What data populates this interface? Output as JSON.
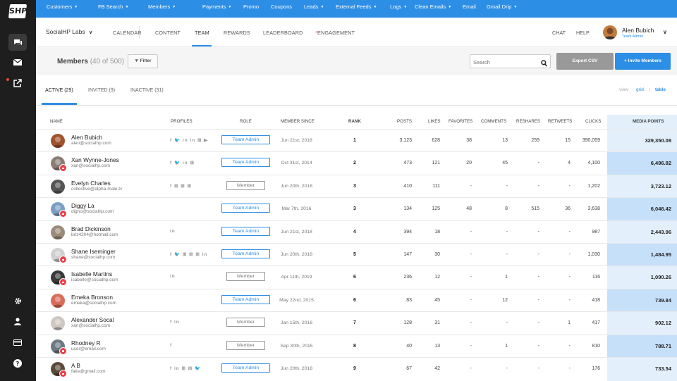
{
  "logo": "SHP",
  "nav": [
    {
      "label": "Customers",
      "caret": true
    },
    {
      "label": "FB Search",
      "caret": true
    },
    {
      "label": "Members",
      "caret": true
    },
    {
      "label": "Payments",
      "caret": true
    },
    {
      "label": "Promo",
      "caret": false
    },
    {
      "label": "Coupons",
      "caret": false
    },
    {
      "label": "Leads",
      "caret": true
    },
    {
      "label": "External Feeds",
      "caret": true
    },
    {
      "label": "Logs",
      "caret": true
    },
    {
      "label": "Clean Emails",
      "caret": true
    },
    {
      "label": "Email",
      "caret": false
    },
    {
      "label": "Gmail Drip",
      "caret": true
    }
  ],
  "sidebar": {
    "icons": [
      "chat-icon",
      "mail-icon",
      "external-link-icon",
      "gear-icon",
      "user-icon",
      "credit-card-icon",
      "help-icon"
    ]
  },
  "header": {
    "org": "SocialHP Labs",
    "tabs": [
      "CALENDAR",
      "CONTENT",
      "TEAM",
      "REWARDS",
      "LEADERBOARD",
      "ENGAGEMENT"
    ],
    "active_tab": "TEAM",
    "engagement_marker": "*",
    "chat": "CHAT",
    "help": "HELP",
    "user_name": "Alen Bubich",
    "user_role": "Team Admin"
  },
  "toolbar": {
    "title": "Members",
    "count": "(40 of 500)",
    "filter": "Filter",
    "search_placeholder": "Search",
    "export": "Export CSV",
    "invite": "+ Invite Members"
  },
  "status_tabs": [
    "ACTIVE (29)",
    "INVITED (9)",
    "INACTIVE (31)"
  ],
  "view": {
    "label": "view",
    "grid": "grid",
    "sep": "|",
    "table": "table"
  },
  "columns": [
    "NAME",
    "PROFILES",
    "ROLE",
    "MEMBER SINCE",
    "RANK",
    "POSTS",
    "LIKES",
    "FAVORITES",
    "COMMENTS",
    "RESHARES",
    "RETWEETS",
    "CLICKS",
    "MEDIA POINTS"
  ],
  "colors": {
    "accent": "#2d8ee6",
    "sidebar": "#1e1e1e",
    "lock": "#e8414a"
  },
  "members": [
    {
      "name": "Alen Bubich",
      "email": "alen@socialhp.com",
      "profiles": "f 🐦 in in ⊞ ▶",
      "role": "Team Admin",
      "since": "Jun 21st, 2018",
      "rank": "1",
      "posts": "3,123",
      "likes": "628",
      "favorites": "38",
      "comments": "13",
      "reshares": "259",
      "retweets": "15",
      "clicks": "390,059",
      "points": "329,350.08",
      "locked": false,
      "avatar": "#a0522d",
      "highlight": 0.0
    },
    {
      "name": "Xan Wynne-Jones",
      "email": "xan@socialhp.com",
      "profiles": "f 🐦 in ⊞",
      "role": "Team Admin",
      "since": "Oct 31st, 2014",
      "rank": "2",
      "posts": "473",
      "likes": "121",
      "favorites": "20",
      "comments": "45",
      "reshares": "-",
      "retweets": "4",
      "clicks": "4,100",
      "points": "6,496.82",
      "locked": true,
      "avatar": "#8a7f76",
      "highlight": 1.0
    },
    {
      "name": "Evelyn Charles",
      "email": "collective@alpha-male.tv",
      "profiles": "f ⊞ ⊞ ⊞",
      "role": "Member",
      "since": "Jun 20th, 2018",
      "rank": "3",
      "posts": "410",
      "likes": "111",
      "favorites": "-",
      "comments": "-",
      "reshares": "-",
      "retweets": "-",
      "clicks": "1,202",
      "points": "3,723.12",
      "locked": false,
      "avatar": "#555",
      "highlight": 0.0
    },
    {
      "name": "Diggy La",
      "email": "digno@socialhp.com",
      "profiles": "",
      "role": "Team Admin",
      "since": "Mar 7th, 2016",
      "rank": "3",
      "posts": "134",
      "likes": "125",
      "favorites": "48",
      "comments": "8",
      "reshares": "515",
      "retweets": "36",
      "clicks": "3,638",
      "points": "6,046.42",
      "locked": true,
      "avatar": "#7a9fc2",
      "highlight": 1.0
    },
    {
      "name": "Brad Dickinson",
      "email": "briz4204@hotmail.com",
      "profiles": "in",
      "role": "Team Admin",
      "since": "Jun 21st, 2018",
      "rank": "4",
      "posts": "394",
      "likes": "18",
      "favorites": "-",
      "comments": "-",
      "reshares": "-",
      "retweets": "-",
      "clicks": "987",
      "points": "2,443.96",
      "locked": false,
      "avatar": "#9a8b7a",
      "highlight": 0.0
    },
    {
      "name": "Shane Iseminger",
      "email": "shane@socialhp.com",
      "profiles": "f 🐦 ⊞ ⊞ ⊞ in",
      "role": "Team Admin",
      "since": "Jun 20th, 2018",
      "rank": "5",
      "posts": "147",
      "likes": "30",
      "favorites": "-",
      "comments": "-",
      "reshares": "-",
      "retweets": "-",
      "clicks": "1,030",
      "points": "1,484.95",
      "locked": true,
      "avatar": "#d0d0d0",
      "highlight": 1.0
    },
    {
      "name": "Isabelle Martins",
      "email": "isabelle@socialhp.com",
      "profiles": "in",
      "role": "Member",
      "since": "Apr 11th, 2019",
      "rank": "6",
      "posts": "236",
      "likes": "12",
      "favorites": "-",
      "comments": "1",
      "reshares": "-",
      "retweets": "-",
      "clicks": "116",
      "points": "1,090.26",
      "locked": true,
      "avatar": "#3a3a3a",
      "highlight": 0.0
    },
    {
      "name": "Emeka Bronson",
      "email": "emeka@socialhp.com",
      "profiles": "",
      "role": "Team Admin",
      "since": "May 22nd, 2015",
      "rank": "6",
      "posts": "83",
      "likes": "45",
      "favorites": "-",
      "comments": "12",
      "reshares": "-",
      "retweets": "-",
      "clicks": "418",
      "points": "739.84",
      "locked": false,
      "avatar": "#d96c5a",
      "highlight": 1.0
    },
    {
      "name": "Alexander Socal",
      "email": "xan@socialhp.com",
      "profiles": "f in",
      "role": "Member",
      "since": "Jan 15th, 2016",
      "rank": "7",
      "posts": "128",
      "likes": "31",
      "favorites": "-",
      "comments": "-",
      "reshares": "-",
      "retweets": "1",
      "clicks": "417",
      "points": "902.12",
      "locked": false,
      "avatar": "#cfc8c2",
      "highlight": 0.0
    },
    {
      "name": "Rhodney R",
      "email": "user@email.com",
      "profiles": "f",
      "role": "Member",
      "since": "Sep 30th, 2015",
      "rank": "8",
      "posts": "40",
      "likes": "13",
      "favorites": "-",
      "comments": "1",
      "reshares": "-",
      "retweets": "-",
      "clicks": "810",
      "points": "788.71",
      "locked": true,
      "avatar": "#6b7a80",
      "highlight": 1.0
    },
    {
      "name": "A B",
      "email": "fake@gmail.com",
      "profiles": "f in ⊞ ⊞ 🐦",
      "role": "Team Admin",
      "since": "Jun 20th, 2018",
      "rank": "9",
      "posts": "67",
      "likes": "42",
      "favorites": "-",
      "comments": "-",
      "reshares": "-",
      "retweets": "-",
      "clicks": "176",
      "points": "733.54",
      "locked": true,
      "avatar": "#5a4a3a",
      "highlight": 0.0
    }
  ]
}
